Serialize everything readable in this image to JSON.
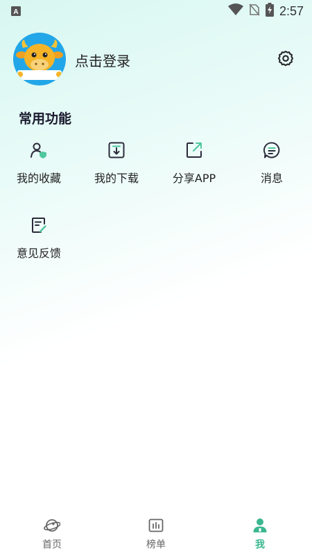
{
  "status_bar": {
    "time": "2:57",
    "left_icon": "keyboard-a-icon",
    "icons": [
      "wifi-icon",
      "no-sim-icon",
      "battery-charging-icon"
    ]
  },
  "header": {
    "login_text": "点击登录",
    "avatar_icon": "cow-mascot-avatar",
    "settings_icon": "gear-icon"
  },
  "section": {
    "title": "常用功能"
  },
  "features": [
    {
      "label": "我的收藏",
      "icon": "user-favorite-icon"
    },
    {
      "label": "我的下载",
      "icon": "download-icon"
    },
    {
      "label": "分享APP",
      "icon": "share-icon"
    },
    {
      "label": "消息",
      "icon": "message-icon"
    },
    {
      "label": "意见反馈",
      "icon": "feedback-icon"
    }
  ],
  "bottom_nav": {
    "items": [
      {
        "label": "首页",
        "icon": "planet-icon",
        "active": false
      },
      {
        "label": "榜单",
        "icon": "chart-icon",
        "active": false
      },
      {
        "label": "我",
        "icon": "person-icon",
        "active": true
      }
    ]
  },
  "colors": {
    "accent": "#3bb78f",
    "avatar_bg": "#22a6e8",
    "gradient_top": "#d8f7f0"
  }
}
